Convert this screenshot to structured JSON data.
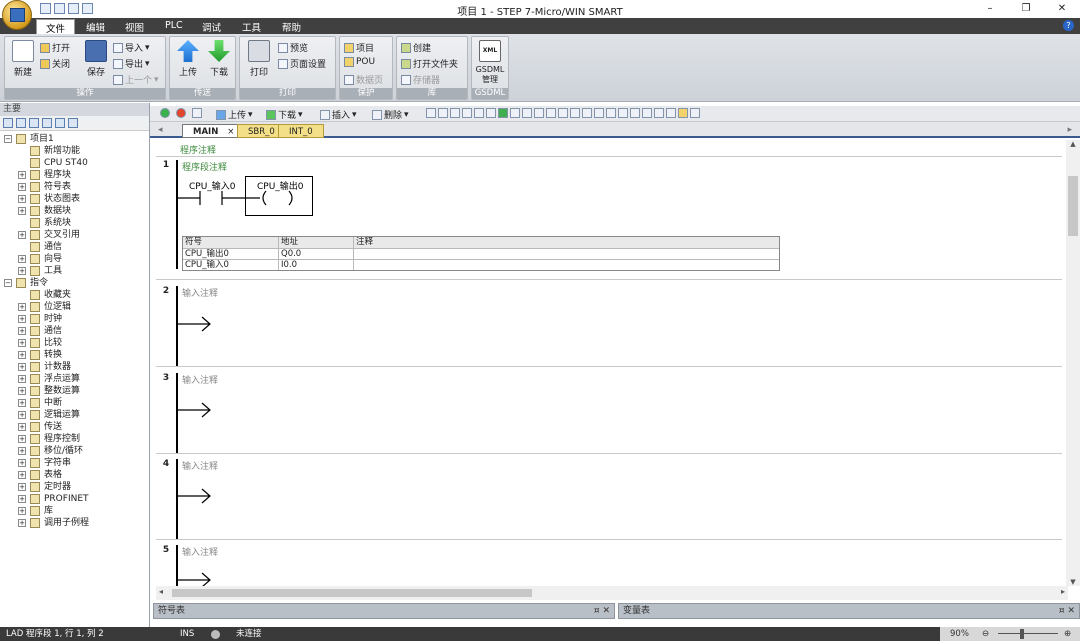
{
  "window": {
    "title": "项目 1 - STEP 7-Micro/WIN SMART",
    "minimize": "–",
    "maximize": "❐",
    "close": "✕"
  },
  "menu": {
    "items": [
      "文件",
      "编辑",
      "视图",
      "PLC",
      "调试",
      "工具",
      "帮助"
    ]
  },
  "ribbon": {
    "groups": [
      "操作",
      "传送",
      "打印",
      "保护",
      "库",
      "GSDML"
    ],
    "new": "新建",
    "open": "打开",
    "close": "关闭",
    "save": "保存",
    "import": "导入",
    "export": "导出",
    "prev": "上一个",
    "upload": "上传",
    "download": "下载",
    "print": "打印",
    "preview": "预览",
    "page_setup": "页面设置",
    "project": "项目",
    "pou": "POU",
    "data_page": "数据页",
    "create": "创建",
    "open_folder": "打开文件夹",
    "storage": "存储器",
    "gsdml_xml": "XML",
    "gsdml_label": "GSDML",
    "gsdml_manage": "管理"
  },
  "leftpane": {
    "title": "主要"
  },
  "tree": [
    {
      "label": "项目1",
      "level": 0,
      "pm": "-"
    },
    {
      "label": "新增功能",
      "level": 1,
      "pm": ""
    },
    {
      "label": "CPU ST40",
      "level": 1,
      "pm": ""
    },
    {
      "label": "程序块",
      "level": 1,
      "pm": "+"
    },
    {
      "label": "符号表",
      "level": 1,
      "pm": "+"
    },
    {
      "label": "状态图表",
      "level": 1,
      "pm": "+"
    },
    {
      "label": "数据块",
      "level": 1,
      "pm": "+"
    },
    {
      "label": "系统块",
      "level": 1,
      "pm": ""
    },
    {
      "label": "交叉引用",
      "level": 1,
      "pm": "+"
    },
    {
      "label": "通信",
      "level": 1,
      "pm": ""
    },
    {
      "label": "向导",
      "level": 1,
      "pm": "+"
    },
    {
      "label": "工具",
      "level": 1,
      "pm": "+"
    },
    {
      "label": "指令",
      "level": 0,
      "pm": "-"
    },
    {
      "label": "收藏夹",
      "level": 1,
      "pm": ""
    },
    {
      "label": "位逻辑",
      "level": 1,
      "pm": "+"
    },
    {
      "label": "时钟",
      "level": 1,
      "pm": "+"
    },
    {
      "label": "通信",
      "level": 1,
      "pm": "+"
    },
    {
      "label": "比较",
      "level": 1,
      "pm": "+"
    },
    {
      "label": "转换",
      "level": 1,
      "pm": "+"
    },
    {
      "label": "计数器",
      "level": 1,
      "pm": "+"
    },
    {
      "label": "浮点运算",
      "level": 1,
      "pm": "+"
    },
    {
      "label": "整数运算",
      "level": 1,
      "pm": "+"
    },
    {
      "label": "中断",
      "level": 1,
      "pm": "+"
    },
    {
      "label": "逻辑运算",
      "level": 1,
      "pm": "+"
    },
    {
      "label": "传送",
      "level": 1,
      "pm": "+"
    },
    {
      "label": "程序控制",
      "level": 1,
      "pm": "+"
    },
    {
      "label": "移位/循环",
      "level": 1,
      "pm": "+"
    },
    {
      "label": "字符串",
      "level": 1,
      "pm": "+"
    },
    {
      "label": "表格",
      "level": 1,
      "pm": "+"
    },
    {
      "label": "定时器",
      "level": 1,
      "pm": "+"
    },
    {
      "label": "PROFINET",
      "level": 1,
      "pm": "+"
    },
    {
      "label": "库",
      "level": 1,
      "pm": "+"
    },
    {
      "label": "调用子例程",
      "level": 1,
      "pm": "+"
    }
  ],
  "edtoolbar": {
    "upload": "上传",
    "download": "下载",
    "insert": "插入",
    "delete": "删除"
  },
  "tabs": [
    "MAIN",
    "SBR_0",
    "INT_0"
  ],
  "program": {
    "program_comment": "程序注释",
    "networks": [
      {
        "num": "1",
        "comment": "程序段注释"
      },
      {
        "num": "2",
        "comment": "输入注释"
      },
      {
        "num": "3",
        "comment": "输入注释"
      },
      {
        "num": "4",
        "comment": "输入注释"
      },
      {
        "num": "5",
        "comment": "输入注释"
      }
    ],
    "contact_label": "CPU_输入0",
    "coil_label": "CPU_输出0",
    "symbol_table": {
      "headers": [
        "符号",
        "地址",
        "注释"
      ],
      "rows": [
        [
          "CPU_输出0",
          "Q0.0",
          ""
        ],
        [
          "CPU_输入0",
          "I0.0",
          ""
        ]
      ]
    }
  },
  "bottom": {
    "symbol_table": "符号表",
    "var_table": "变量表"
  },
  "status": {
    "position": "LAD 程序段 1, 行 1, 列 2",
    "mode": "INS",
    "connection": "未连接",
    "zoom": "90%"
  }
}
